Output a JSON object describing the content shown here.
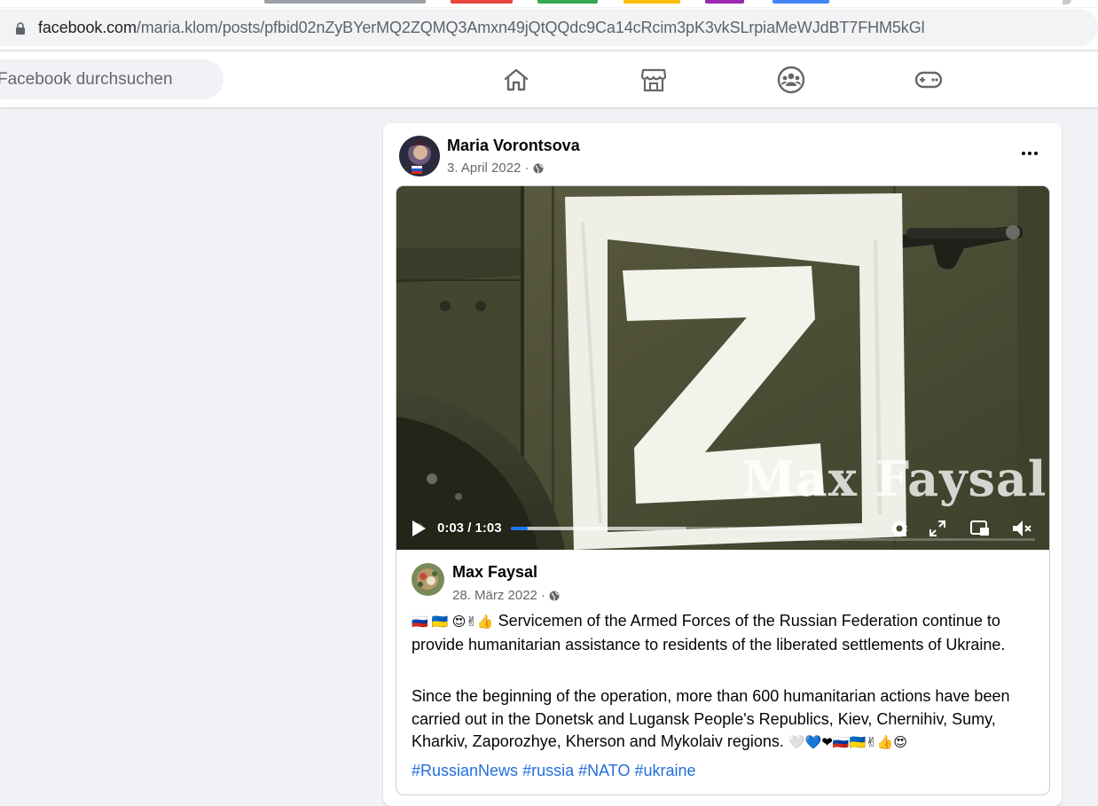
{
  "browser": {
    "url_domain": "facebook.com",
    "url_path": "/maria.klom/posts/pfbid02nZyBYerMQ2ZQMQ3Amxn49jQtQQdc9Ca14cRcim3pK3vkSLrpiaMeWJdBT7FHM5kGl"
  },
  "nav": {
    "search_placeholder": "Facebook durchsuchen",
    "icons": [
      "home-icon",
      "marketplace-icon",
      "groups-icon",
      "gaming-icon"
    ]
  },
  "post": {
    "author": "Maria Vorontsova",
    "date": "3. April 2022 ·",
    "shared": {
      "video": {
        "watermark": "Max Faysal",
        "time": "0:03 / 1:03",
        "progress": 0.0476,
        "buffered": 0.5
      },
      "author": "Max Faysal",
      "date": "28. März 2022 ·",
      "text_lead_emoji": "🇷🇺 🇺🇦 😍✌👍",
      "text_p1": "Servicemen of the Armed Forces of the Russian Federation continue to provide humanitarian assistance to residents of the liberated settlements of Ukraine.",
      "text_p2": "Since the beginning of the operation, more than 600 humanitarian actions have been carried out in the Donetsk and Lugansk People's Republics, Kiev, Chernihiv, Sumy, Kharkiv, Zaporozhye, Kherson and Mykolaiv regions.",
      "text_p2_emoji": "🤍💙❤🇷🇺🇺🇦✌👍😍",
      "hashtags": [
        "#RussianNews",
        "#russia",
        "#NATO",
        "#ukraine"
      ]
    }
  },
  "colors": {
    "link": "#216fdb",
    "progress": "#1877f2",
    "page_bg": "#f0f2f5"
  }
}
